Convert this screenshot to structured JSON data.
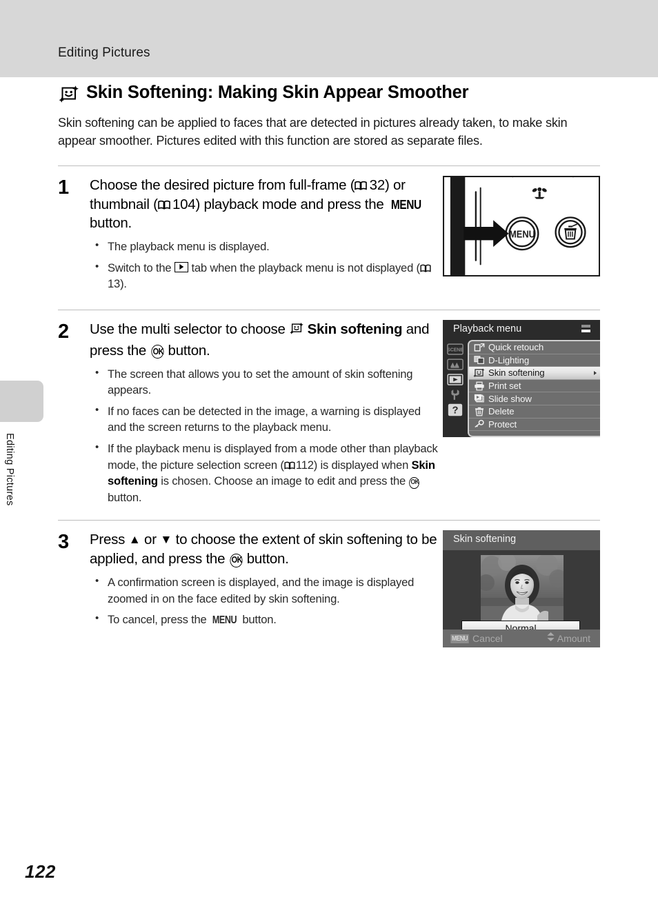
{
  "header": {
    "running_head": "Editing Pictures"
  },
  "sidebar": {
    "vertical_label": "Editing Pictures"
  },
  "heading": {
    "icon": "skin-softening-icon",
    "title": "Skin Softening: Making Skin Appear Smoother"
  },
  "intro": {
    "text": "Skin softening can be applied to faces that are detected in pictures already taken, to make skin appear smoother. Pictures edited with this function are stored as separate files."
  },
  "steps": [
    {
      "number": "1",
      "head_parts": {
        "p1": "Choose the desired picture from full-frame (",
        "ref1": "32",
        "p2": ") or thumbnail (",
        "ref2": "104",
        "p3": ") playback mode and press the ",
        "menu": "MENU",
        "p4": " button."
      },
      "bullets": [
        {
          "p1": "The playback menu is displayed."
        },
        {
          "p1": "Switch to the ",
          "icon": "playback-tab-icon",
          "p2": " tab when the playback menu is not displayed (",
          "ref": "13",
          "p3": ")."
        }
      ]
    },
    {
      "number": "2",
      "head_parts": {
        "p1": "Use the multi selector to choose ",
        "icon": "skin-softening-icon",
        "b1": "Skin softening",
        "p2": " and press the ",
        "ok": "OK",
        "p3": " button."
      },
      "bullets": [
        {
          "p1": "The screen that allows you to set the amount of skin softening appears."
        },
        {
          "p1": "If no faces can be detected in the image, a warning is displayed and the screen returns to the playback menu."
        },
        {
          "p1": "If the playback menu is displayed from a mode other than playback mode, the picture selection screen (",
          "ref": "112",
          "p2": ") is displayed when ",
          "b1": "Skin softening",
          "p3": " is chosen. Choose an image to edit and press the ",
          "ok": "OK",
          "p4": " button."
        }
      ]
    },
    {
      "number": "3",
      "head_parts": {
        "p1": "Press ",
        "up": "▲",
        "p2": " or ",
        "down": "▼",
        "p3": " to choose the extent of skin softening to be applied, and press the ",
        "ok": "OK",
        "p4": " button."
      },
      "bullets": [
        {
          "p1": "A confirmation screen is displayed, and the image is displayed zoomed in on the face edited by skin softening."
        },
        {
          "p1": "To cancel, press the ",
          "menu": "MENU",
          "p2": " button."
        }
      ]
    }
  ],
  "figures": {
    "camera_back": {
      "name": "camera-back-illustration",
      "menu_button_label": "MENU",
      "delete_button_icon": "trash-icon",
      "macro_icon": "macro-flower-icon",
      "arrow_icon": "right-arrow-pointer"
    },
    "playback_menu": {
      "title": "Playback menu",
      "page_indicator": "scroll-indicator",
      "tabs": [
        {
          "name": "tab-scene",
          "label": "SCENE",
          "selected": false
        },
        {
          "name": "tab-movie",
          "label": "",
          "selected": false
        },
        {
          "name": "tab-playback",
          "label": "",
          "selected": true
        },
        {
          "name": "tab-setup",
          "label": "",
          "selected": false
        },
        {
          "name": "tab-help",
          "label": "?",
          "selected": false
        }
      ],
      "items": [
        {
          "icon": "quick-retouch-icon",
          "label": "Quick retouch",
          "selected": false
        },
        {
          "icon": "d-lighting-icon",
          "label": "D-Lighting",
          "selected": false
        },
        {
          "icon": "skin-softening-icon",
          "label": "Skin softening",
          "selected": true
        },
        {
          "icon": "print-set-icon",
          "label": "Print set",
          "selected": false
        },
        {
          "icon": "slide-show-icon",
          "label": "Slide show",
          "selected": false
        },
        {
          "icon": "trash-icon",
          "label": "Delete",
          "selected": false
        },
        {
          "icon": "protect-key-icon",
          "label": "Protect",
          "selected": false
        }
      ]
    },
    "skin_softening_screen": {
      "title": "Skin softening",
      "amount_value": "Normal",
      "footer_left_chip": "MENU",
      "footer_left_label": "Cancel",
      "footer_right_icon": "up-down-arrow-icon",
      "footer_right_label": "Amount",
      "photo": "portrait-of-smiling-woman-outdoors"
    }
  },
  "footer": {
    "page_number": "122"
  },
  "colors": {
    "header_band": "#d7d7d7",
    "side_tab": "#d0d0d0",
    "lcd_dark": "#2b2b2b",
    "lcd_menu_bg": "#6e6e6e",
    "lcd_selected": "#e9e9e9",
    "rule": "#bdbdbd"
  }
}
